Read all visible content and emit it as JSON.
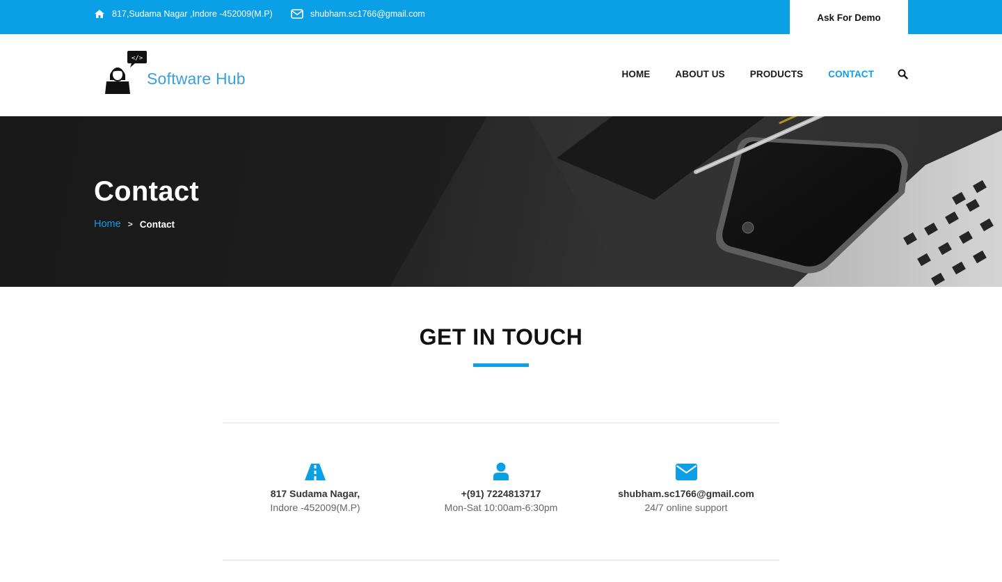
{
  "topbar": {
    "address": "817,Sudama Nagar ,Indore -452009(M.P)",
    "email": "shubham.sc1766@gmail.com",
    "demo_button": "Ask For Demo",
    "address_icon": "home-icon",
    "email_icon": "envelope-icon"
  },
  "brand": {
    "name": "Software Hub",
    "logo_code_text": "</>"
  },
  "nav": {
    "items": [
      {
        "label": "HOME"
      },
      {
        "label": "ABOUT US"
      },
      {
        "label": "PRODUCTS"
      },
      {
        "label": "CONTACT",
        "active": true
      }
    ],
    "search_icon": "search-icon"
  },
  "hero": {
    "title": "Contact",
    "breadcrumb": {
      "home": "Home",
      "separator": ">",
      "current": "Contact"
    }
  },
  "section": {
    "title": "GET IN TOUCH"
  },
  "contacts": [
    {
      "icon": "road-icon",
      "main": "817 Sudama Nagar,",
      "sub": "Indore -452009(M.P)"
    },
    {
      "icon": "user-icon",
      "main": "+(91) 7224813717",
      "sub": "Mon-Sat 10:00am-6:30pm"
    },
    {
      "icon": "envelope-icon",
      "main": "shubham.sc1766@gmail.com",
      "sub": "24/7 online support"
    }
  ],
  "colors": {
    "accent": "#0ba0e6",
    "logo_text": "#3a9fdd",
    "hero_dark": "#2a2a2a"
  }
}
